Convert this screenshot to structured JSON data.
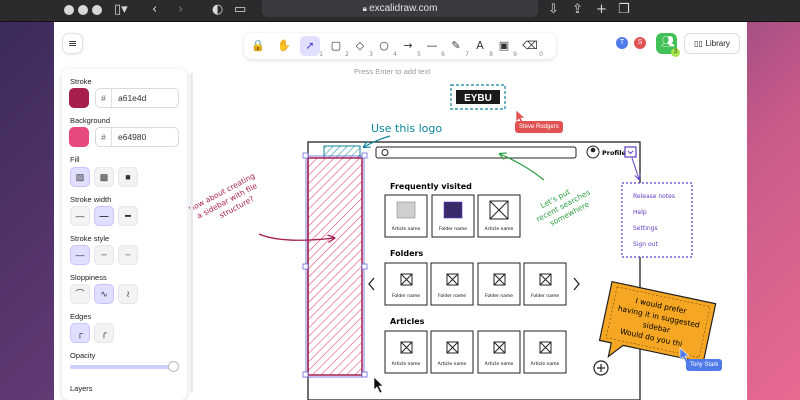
{
  "browser": {
    "url": "excalidraw.com"
  },
  "toolbar": {
    "tools": [
      {
        "name": "lock",
        "glyph": "🔒",
        "num": ""
      },
      {
        "name": "hand",
        "glyph": "✋",
        "num": ""
      },
      {
        "name": "selection",
        "glyph": "➚",
        "num": "1",
        "active": true
      },
      {
        "name": "rectangle",
        "glyph": "▢",
        "num": "2"
      },
      {
        "name": "diamond",
        "glyph": "◇",
        "num": "3"
      },
      {
        "name": "ellipse",
        "glyph": "○",
        "num": "4"
      },
      {
        "name": "arrow",
        "glyph": "→",
        "num": "5"
      },
      {
        "name": "line",
        "glyph": "—",
        "num": "6"
      },
      {
        "name": "draw",
        "glyph": "✎",
        "num": "7"
      },
      {
        "name": "text",
        "glyph": "A",
        "num": "8"
      },
      {
        "name": "image",
        "glyph": "▣",
        "num": "9"
      },
      {
        "name": "eraser",
        "glyph": "⌫",
        "num": "0"
      }
    ],
    "hint": "Press Enter to add text"
  },
  "collaborators": [
    {
      "initial": "T",
      "color": "#4f7be8"
    },
    {
      "initial": "S",
      "color": "#e05252"
    }
  ],
  "share": {
    "count": "3"
  },
  "library_label": "Library",
  "properties": {
    "stroke_label": "Stroke",
    "stroke_hex": "a61e4d",
    "stroke_color": "#a61e4d",
    "background_label": "Background",
    "background_hex": "e64980",
    "background_color": "#e64980",
    "fill_label": "Fill",
    "stroke_width_label": "Stroke width",
    "stroke_style_label": "Stroke style",
    "sloppiness_label": "Sloppiness",
    "edges_label": "Edges",
    "opacity_label": "Opacity",
    "opacity_value": 0.98,
    "layers_label": "Layers"
  },
  "drawing": {
    "logo_text": "EYBU",
    "use_logo": "Use this logo",
    "sidebar_note_1": "How about creating",
    "sidebar_note_2": "a sidebar with file",
    "sidebar_note_3": "structure?",
    "search_note_1": "Let's put",
    "search_note_2": "recent searches",
    "search_note_3": "somewhere",
    "profile": "Profile",
    "frequently_visited": "Frequently visited",
    "folders": "Folders",
    "articles": "Articles",
    "article_name": "Article name",
    "folder_name": "Folder name",
    "menu": [
      "Release notes",
      "Help",
      "Settings",
      "Sign out"
    ],
    "sticky_1": "I would prefer",
    "sticky_2": "having it in suggested",
    "sticky_3": "sidebar",
    "sticky_4": "Would do you thi",
    "cursor_steve": "Steve Rodgers",
    "cursor_tony": "Tony Stark"
  },
  "colors": {
    "accent": "#6965db",
    "pink": "#e64980",
    "teal": "#0c8599",
    "green": "#2f9e44",
    "purple": "#5f3dc4",
    "orange": "#f59f00"
  }
}
